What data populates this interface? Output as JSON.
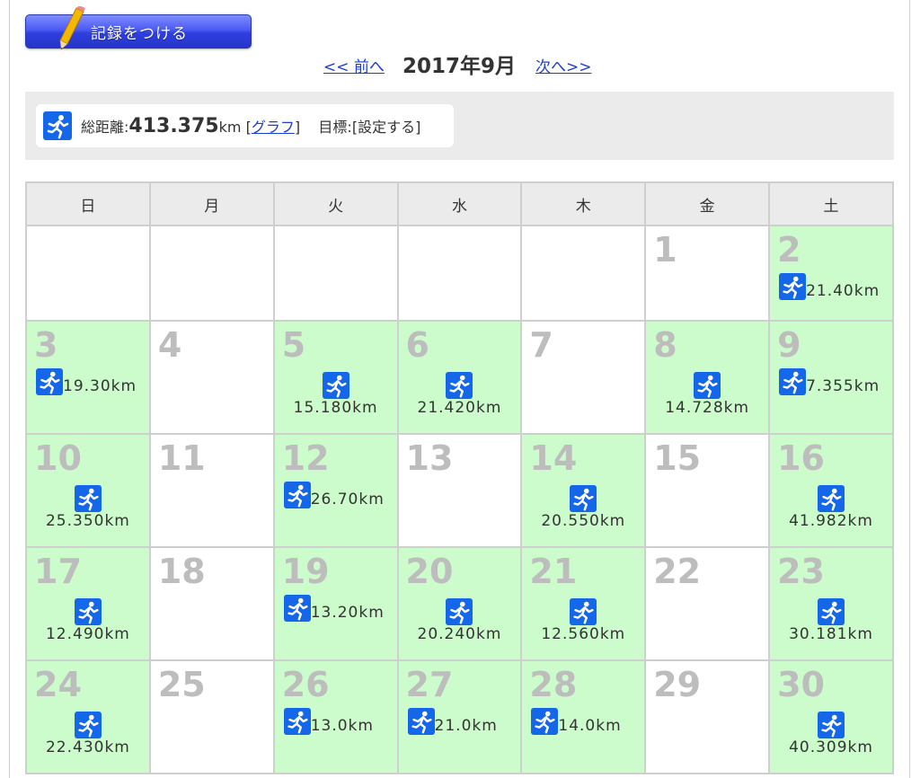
{
  "record_button": {
    "label": "記録をつける"
  },
  "nav": {
    "prev": "<< 前へ",
    "title": "2017年9月",
    "next": "次へ>>"
  },
  "summary": {
    "total_label": "総距離:",
    "total_value": "413.375",
    "total_unit": "km",
    "graph_open": "[",
    "graph_link": "グラフ",
    "graph_close": "]",
    "goal_label": "目標:",
    "goal_link": "[設定する]"
  },
  "weekdays": [
    "日",
    "月",
    "火",
    "水",
    "木",
    "金",
    "土"
  ],
  "colors": {
    "run_bg": "#ccfbcc",
    "icon": "#1467e8",
    "link": "#1a3fd0",
    "button": "#3a4af0"
  },
  "weeks": [
    [
      {
        "day": "",
        "dist": "",
        "layout": ""
      },
      {
        "day": "",
        "dist": "",
        "layout": ""
      },
      {
        "day": "",
        "dist": "",
        "layout": ""
      },
      {
        "day": "",
        "dist": "",
        "layout": ""
      },
      {
        "day": "",
        "dist": "",
        "layout": ""
      },
      {
        "day": "1",
        "dist": "",
        "layout": ""
      },
      {
        "day": "2",
        "dist": "21.40km",
        "layout": "inline"
      }
    ],
    [
      {
        "day": "3",
        "dist": "19.30km",
        "layout": "inline"
      },
      {
        "day": "4",
        "dist": "",
        "layout": ""
      },
      {
        "day": "5",
        "dist": "15.180km",
        "layout": "stack"
      },
      {
        "day": "6",
        "dist": "21.420km",
        "layout": "stack"
      },
      {
        "day": "7",
        "dist": "",
        "layout": ""
      },
      {
        "day": "8",
        "dist": "14.728km",
        "layout": "stack"
      },
      {
        "day": "9",
        "dist": "7.355km",
        "layout": "inline"
      }
    ],
    [
      {
        "day": "10",
        "dist": "25.350km",
        "layout": "stack"
      },
      {
        "day": "11",
        "dist": "",
        "layout": ""
      },
      {
        "day": "12",
        "dist": "26.70km",
        "layout": "inline"
      },
      {
        "day": "13",
        "dist": "",
        "layout": ""
      },
      {
        "day": "14",
        "dist": "20.550km",
        "layout": "stack"
      },
      {
        "day": "15",
        "dist": "",
        "layout": ""
      },
      {
        "day": "16",
        "dist": "41.982km",
        "layout": "stack"
      }
    ],
    [
      {
        "day": "17",
        "dist": "12.490km",
        "layout": "stack"
      },
      {
        "day": "18",
        "dist": "",
        "layout": ""
      },
      {
        "day": "19",
        "dist": "13.20km",
        "layout": "inline"
      },
      {
        "day": "20",
        "dist": "20.240km",
        "layout": "stack"
      },
      {
        "day": "21",
        "dist": "12.560km",
        "layout": "stack"
      },
      {
        "day": "22",
        "dist": "",
        "layout": ""
      },
      {
        "day": "23",
        "dist": "30.181km",
        "layout": "stack"
      }
    ],
    [
      {
        "day": "24",
        "dist": "22.430km",
        "layout": "stack"
      },
      {
        "day": "25",
        "dist": "",
        "layout": ""
      },
      {
        "day": "26",
        "dist": "13.0km",
        "layout": "inline"
      },
      {
        "day": "27",
        "dist": "21.0km",
        "layout": "inline"
      },
      {
        "day": "28",
        "dist": "14.0km",
        "layout": "inline"
      },
      {
        "day": "29",
        "dist": "",
        "layout": ""
      },
      {
        "day": "30",
        "dist": "40.309km",
        "layout": "stack"
      }
    ]
  ]
}
